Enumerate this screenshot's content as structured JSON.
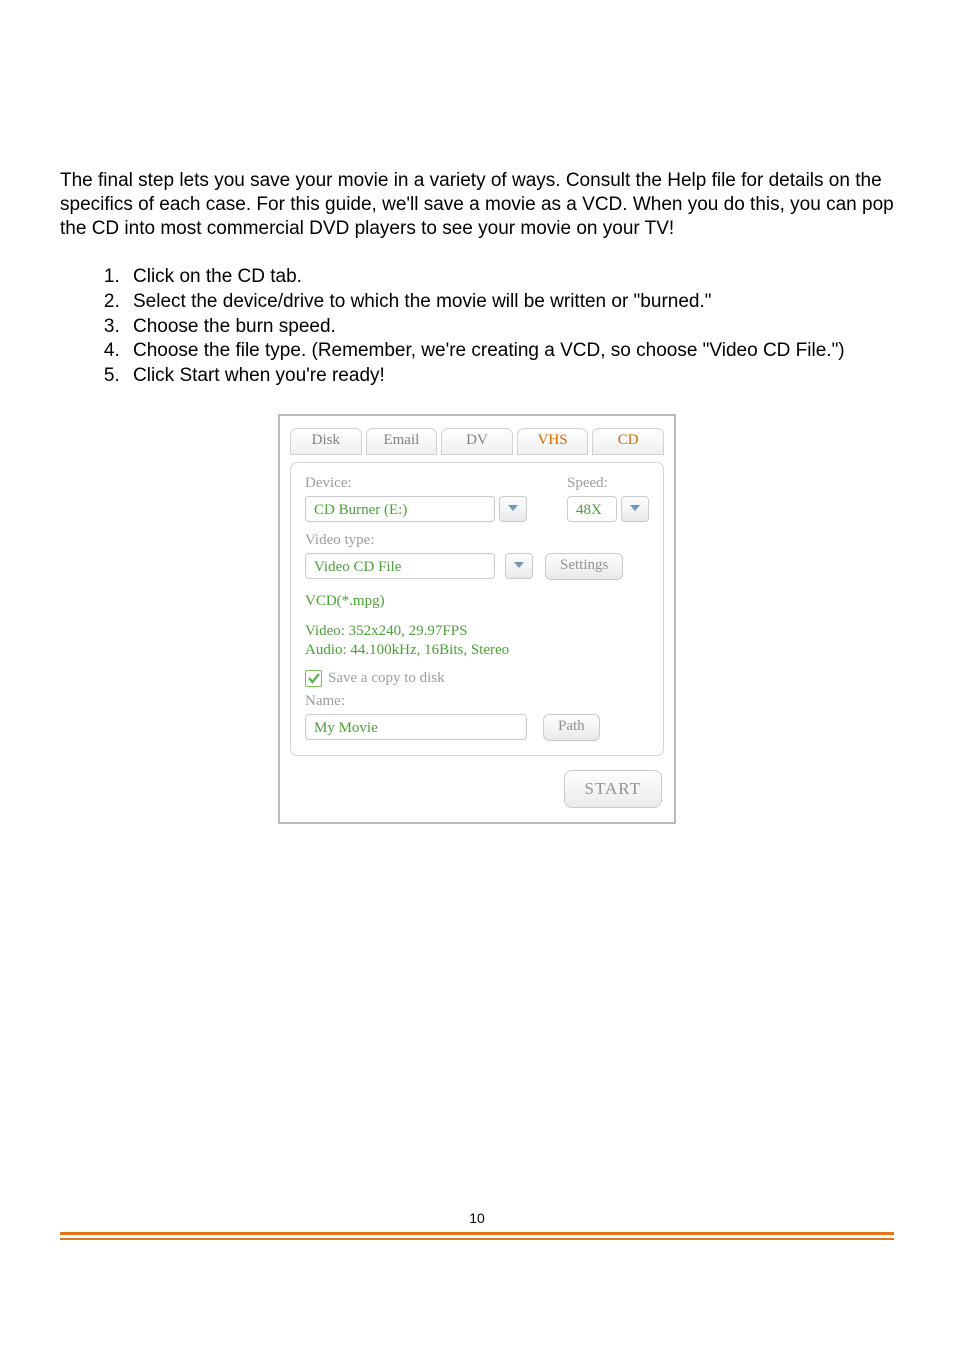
{
  "intro": "The final step lets you save your movie in a variety of ways.  Consult the Help file for details on the specifics of each case.  For this guide, we'll save a movie as a VCD.  When you do this, you can pop the CD into most commercial DVD players to see your movie on your TV!",
  "steps": [
    "Click on the CD tab.",
    "Select the device/drive to which the movie will be written or \"burned.\"",
    "Choose the burn speed.",
    "Choose the file type.  (Remember, we're creating a VCD, so choose \"Video CD File.\")",
    "Click Start when you're ready!"
  ],
  "tabs": {
    "disk": "Disk",
    "email": "Email",
    "dv": "DV",
    "vhs": "VHS",
    "cd": "CD"
  },
  "panel": {
    "device_label": "Device:",
    "device_value": "CD Burner (E:)",
    "speed_label": "Speed:",
    "speed_value": "48X",
    "videotype_label": "Video type:",
    "videotype_value": "Video CD File",
    "settings_btn": "Settings",
    "format_line": "VCD(*.mpg)",
    "video_info": "Video: 352x240, 29.97FPS",
    "audio_info": "Audio: 44.100kHz, 16Bits, Stereo",
    "save_copy_label": "Save a copy to disk",
    "save_copy_checked": true,
    "name_label": "Name:",
    "name_value": "My Movie",
    "path_btn": "Path",
    "start_btn": "START"
  },
  "page_number": "10"
}
